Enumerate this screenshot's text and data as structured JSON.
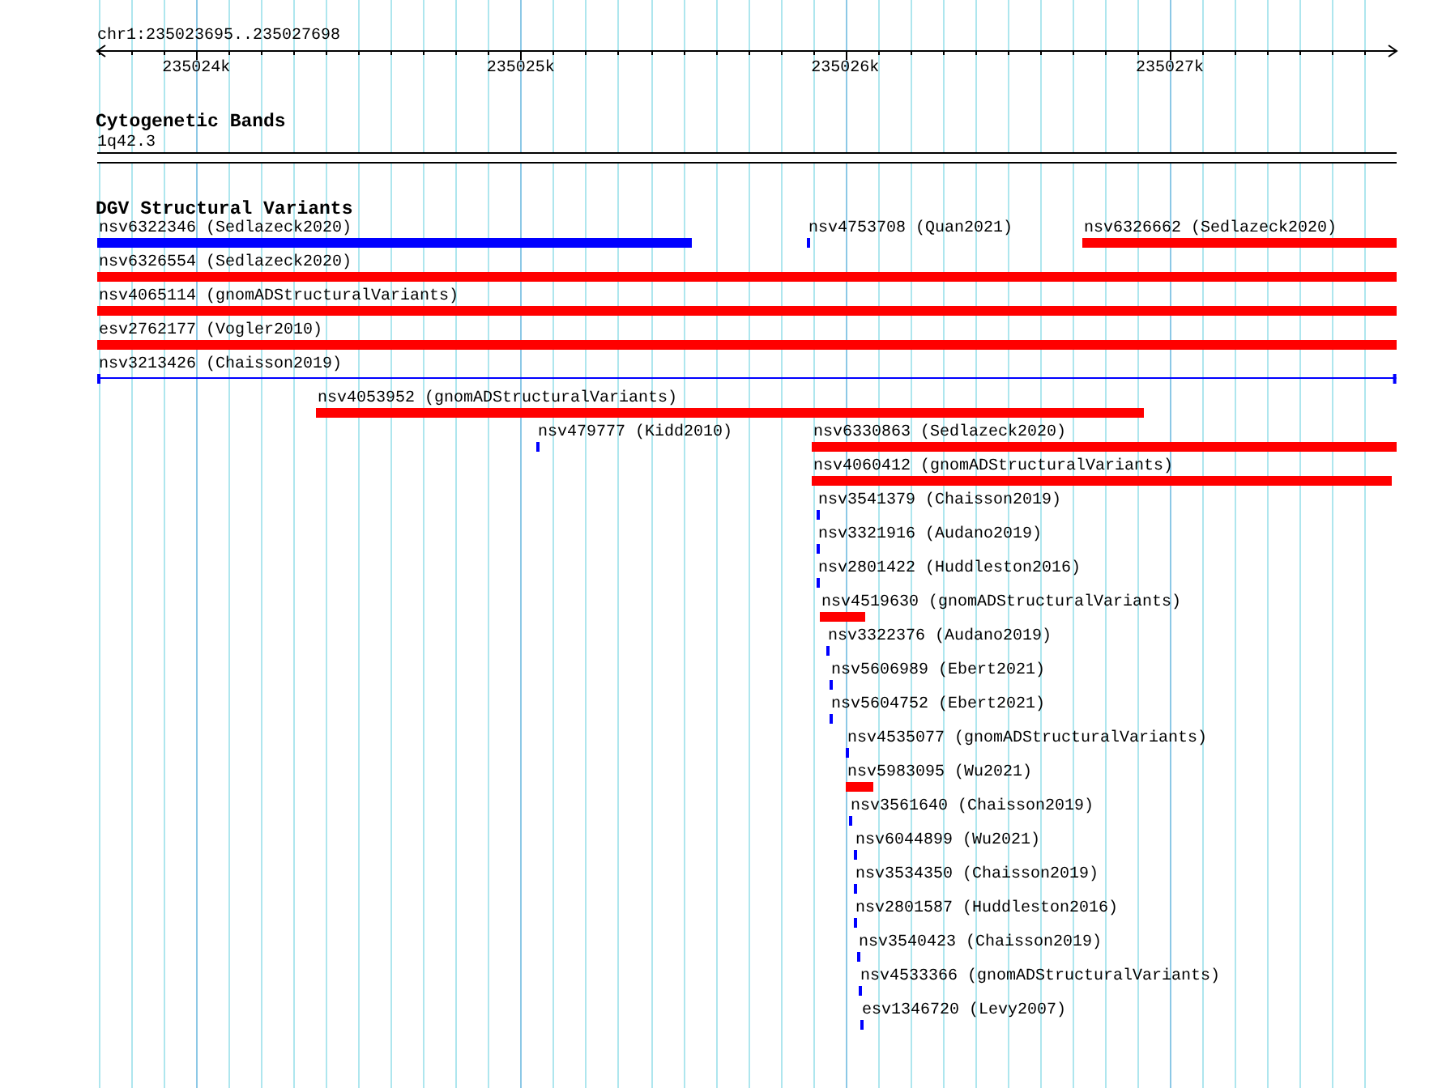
{
  "ruler": {
    "title": "chr1:235023695..235027698",
    "ticks": [
      "235024k",
      "235025k",
      "235026k",
      "235027k"
    ]
  },
  "tracks": [
    {
      "kind": "cytoband",
      "title": "Cytogenetic Bands",
      "band": "1q42.3"
    },
    {
      "kind": "variants",
      "title": "DGV Structural Variants",
      "features": [
        {
          "kind": "bar",
          "label": "nsv6322346 (Sedlazeck2020)",
          "color": "#0000ff"
        },
        {
          "kind": "bar",
          "label": "nsv4753708 (Quan2021)",
          "color": "#0000ff"
        },
        {
          "kind": "bar",
          "label": "nsv6326662 (Sedlazeck2020)",
          "color": "#ff0000"
        },
        {
          "kind": "bar",
          "label": "nsv6326554 (Sedlazeck2020)",
          "color": "#ff0000"
        },
        {
          "kind": "bar",
          "label": "nsv4065114 (gnomADStructuralVariants)",
          "color": "#ff0000"
        },
        {
          "kind": "bar",
          "label": "esv2762177 (Vogler2010)",
          "color": "#ff0000"
        },
        {
          "kind": "line",
          "label": "nsv3213426 (Chaisson2019)",
          "color": "#0000ff"
        },
        {
          "kind": "bar",
          "label": "nsv4053952 (gnomADStructuralVariants)",
          "color": "#ff0000"
        },
        {
          "kind": "bar",
          "label": "nsv479777 (Kidd2010)",
          "color": "#0000ff"
        },
        {
          "kind": "bar",
          "label": "nsv6330863 (Sedlazeck2020)",
          "color": "#ff0000"
        },
        {
          "kind": "bar",
          "label": "nsv4060412 (gnomADStructuralVariants)",
          "color": "#ff0000"
        },
        {
          "kind": "bar",
          "label": "nsv3541379 (Chaisson2019)",
          "color": "#0000ff"
        },
        {
          "kind": "bar",
          "label": "nsv3321916 (Audano2019)",
          "color": "#0000ff"
        },
        {
          "kind": "bar",
          "label": "nsv2801422 (Huddleston2016)",
          "color": "#0000ff"
        },
        {
          "kind": "bar",
          "label": "nsv4519630 (gnomADStructuralVariants)",
          "color": "#ff0000"
        },
        {
          "kind": "bar",
          "label": "nsv3322376 (Audano2019)",
          "color": "#0000ff"
        },
        {
          "kind": "bar",
          "label": "nsv5606989 (Ebert2021)",
          "color": "#0000ff"
        },
        {
          "kind": "bar",
          "label": "nsv5604752 (Ebert2021)",
          "color": "#0000ff"
        },
        {
          "kind": "bar",
          "label": "nsv4535077 (gnomADStructuralVariants)",
          "color": "#0000ff"
        },
        {
          "kind": "bar",
          "label": "nsv5983095 (Wu2021)",
          "color": "#ff0000"
        },
        {
          "kind": "bar",
          "label": "nsv3561640 (Chaisson2019)",
          "color": "#0000ff"
        },
        {
          "kind": "bar",
          "label": "nsv6044899 (Wu2021)",
          "color": "#0000ff"
        },
        {
          "kind": "bar",
          "label": "nsv3534350 (Chaisson2019)",
          "color": "#0000ff"
        },
        {
          "kind": "bar",
          "label": "nsv2801587 (Huddleston2016)",
          "color": "#0000ff"
        },
        {
          "kind": "bar",
          "label": "nsv3540423 (Chaisson2019)",
          "color": "#0000ff"
        },
        {
          "kind": "bar",
          "label": "nsv4533366 (gnomADStructuralVariants)",
          "color": "#0000ff"
        },
        {
          "kind": "bar",
          "label": "esv1346720 (Levy2007)",
          "color": "#0000ff"
        }
      ]
    }
  ]
}
